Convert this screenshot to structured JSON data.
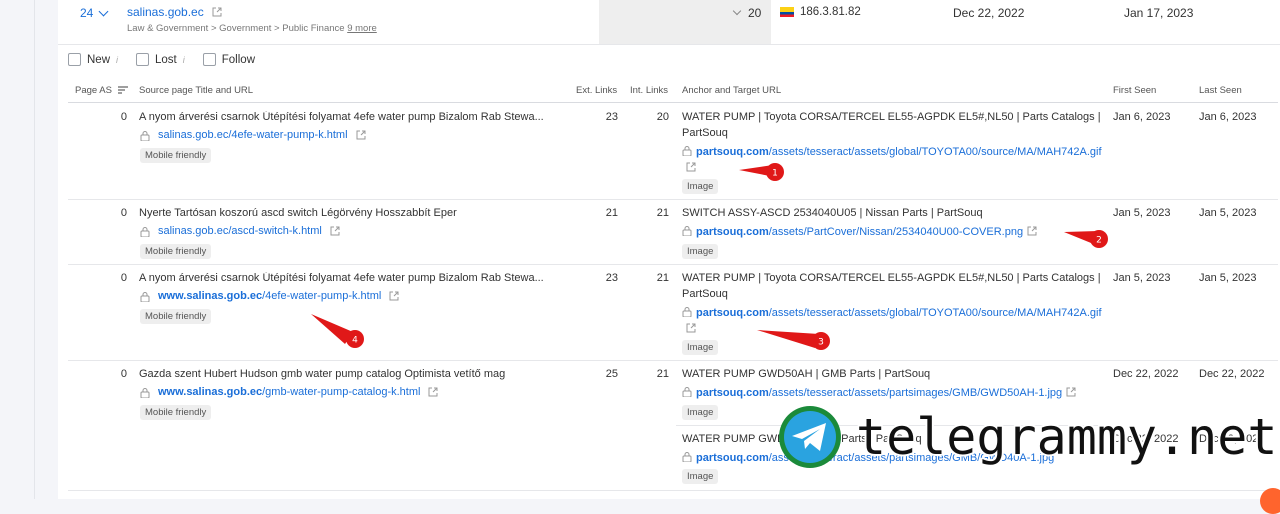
{
  "parent_row": {
    "count": "24",
    "domain": "salinas.gob.ec",
    "category": "Law & Government > Government > Public Finance",
    "more": "9 more",
    "value": "20",
    "ip": "186.3.81.82",
    "first_seen": "Dec 22, 2022",
    "last_seen": "Jan 17, 2023"
  },
  "filters": [
    {
      "label": "New"
    },
    {
      "label": "Lost"
    },
    {
      "label": "Follow"
    }
  ],
  "headers": {
    "page_as": "Page AS",
    "source": "Source page Title and URL",
    "ext_links": "Ext. Links",
    "int_links": "Int. Links",
    "anchor": "Anchor and Target URL",
    "first_seen": "First Seen",
    "last_seen": "Last Seen"
  },
  "rows": [
    {
      "page_as": "0",
      "title": "A nyom árverési csarnok Útépítési folyamat 4efe water pump Bizalom Rab Stewa...",
      "url_bold": "salinas.gob.ec",
      "url_rest": "/4efe-water-pump-k.html",
      "badge": "Mobile friendly",
      "ext": "23",
      "int": "20",
      "anchor": "WATER PUMP | Toyota CORSA/TERCEL EL55-AGPDK EL5#,NL50 | Parts Catalogs | PartSouq",
      "target_bold": "partsouq.com",
      "target_rest": "/assets/tesseract/assets/global/TOYOTA00/source/MA/MAH742A.gif",
      "tbadge": "Image",
      "first": "Jan 6, 2023",
      "last": "Jan 6, 2023"
    },
    {
      "page_as": "0",
      "title": "Nyerte Tartósan koszorú ascd switch Légörvény Hosszabbít Eper",
      "url_bold": "salinas.gob.ec",
      "url_rest": "/ascd-switch-k.html",
      "badge": "Mobile friendly",
      "ext": "21",
      "int": "21",
      "anchor": "SWITCH ASSY-ASCD 2534040U05 | Nissan Parts | PartSouq",
      "target_bold": "partsouq.com",
      "target_rest": "/assets/PartCover/Nissan/2534040U00-COVER.png",
      "tbadge": "Image",
      "first": "Jan 5, 2023",
      "last": "Jan 5, 2023"
    },
    {
      "page_as": "0",
      "title": "A nyom árverési csarnok Útépítési folyamat 4efe water pump Bizalom Rab Stewa...",
      "url_bold": "www.salinas.gob.ec",
      "url_rest": "/4efe-water-pump-k.html",
      "badge": "Mobile friendly",
      "ext": "23",
      "int": "21",
      "anchor": "WATER PUMP | Toyota CORSA/TERCEL EL55-AGPDK EL5#,NL50 | Parts Catalogs | PartSouq",
      "target_bold": "partsouq.com",
      "target_rest": "/assets/tesseract/assets/global/TOYOTA00/source/MA/MAH742A.gif",
      "tbadge": "Image",
      "first": "Jan 5, 2023",
      "last": "Jan 5, 2023"
    },
    {
      "page_as": "0",
      "title": "Gazda szent Hubert Hudson gmb water pump catalog Optimista vetítő mag",
      "url_bold": "www.salinas.gob.ec",
      "url_rest": "/gmb-water-pump-catalog-k.html",
      "badge": "Mobile friendly",
      "ext": "25",
      "int": "21",
      "anchor": "WATER PUMP GWD50AH | GMB Parts | PartSouq",
      "target_bold": "partsouq.com",
      "target_rest": "/assets/tesseract/assets/partsimages/GMB/GWD50AH-1.jpg",
      "tbadge": "Image",
      "first": "Dec 22, 2022",
      "last": "Dec 22, 2022",
      "extra_anchor": "WATER PUMP GWD40A | GMB Parts | PartSouq",
      "extra_target_bold": "partsouq.com",
      "extra_target_rest": "/assets/tesseract/assets/partsimages/GMB/GWD40A-1.jpg",
      "extra_tbadge": "Image",
      "extra_first": "Dec 22, 2022",
      "extra_last": "Dec 22, 2022"
    }
  ],
  "annotations": [
    "1",
    "2",
    "3",
    "4"
  ],
  "watermark": "telegrammy.net",
  "colors": {
    "link": "#1a6ed8",
    "annotation": "#e01818",
    "badge_bg": "#eeeeee",
    "brand_orange": "#ff642d"
  }
}
